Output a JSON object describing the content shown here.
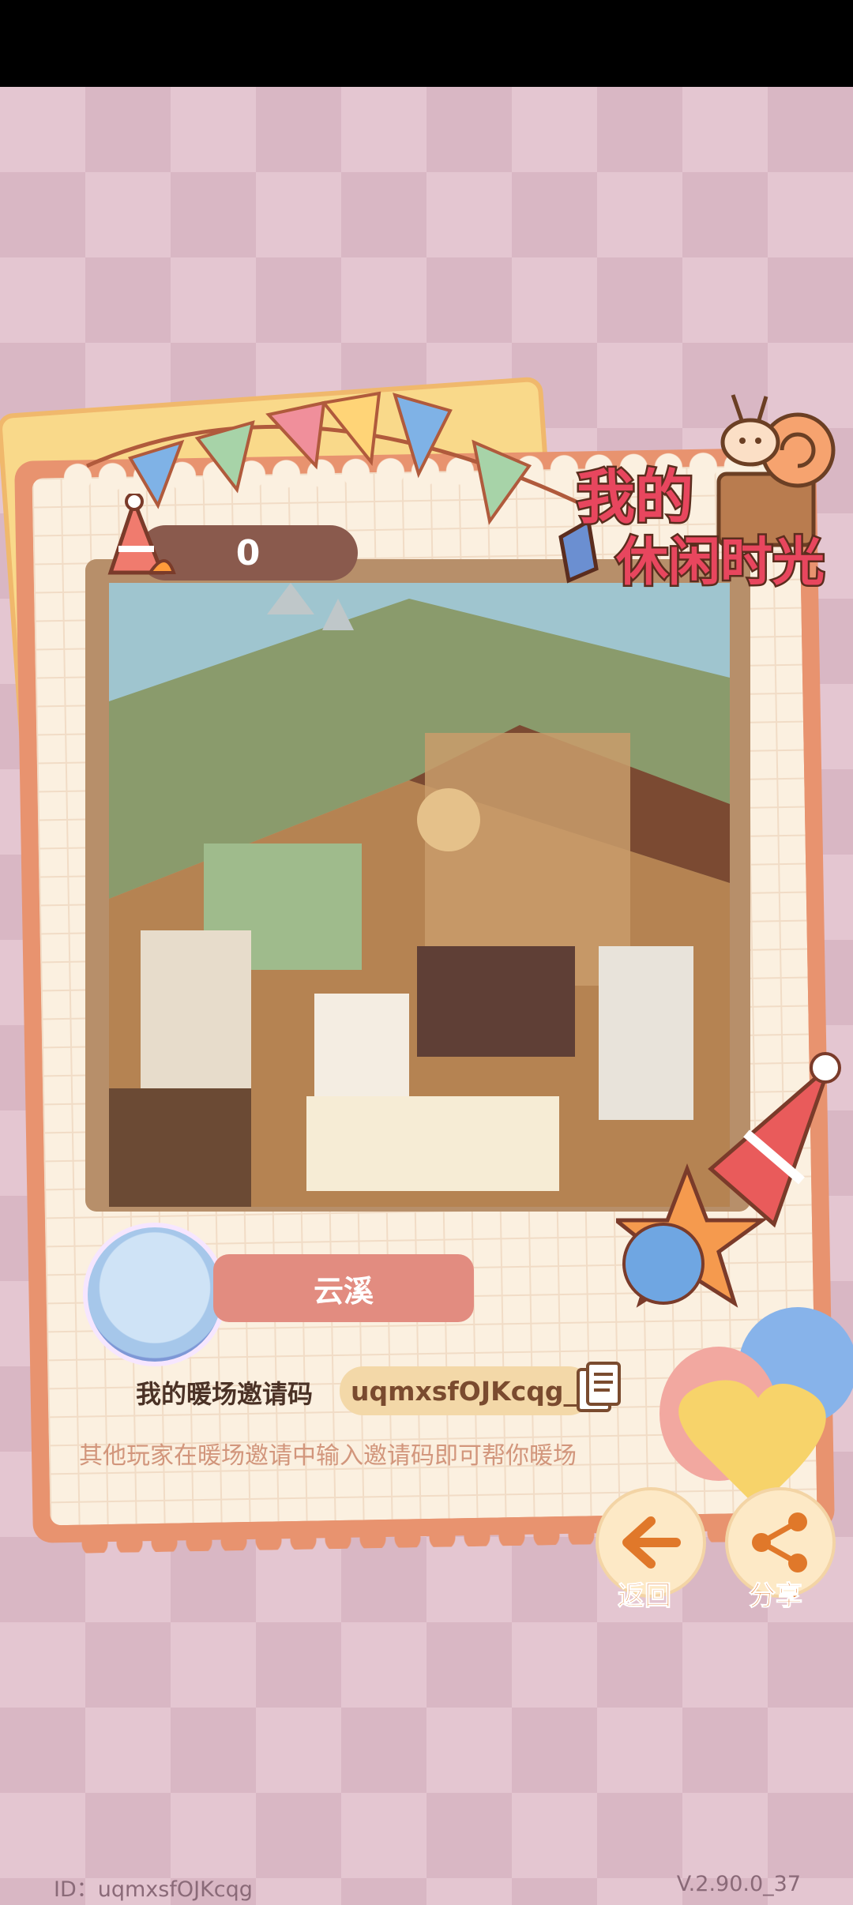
{
  "score": "0",
  "title": {
    "line1": "我的",
    "line2": "休闲时光"
  },
  "player": {
    "name": "云溪"
  },
  "invite": {
    "label": "我的暖场邀请码",
    "code": "uqmxsfOJKcqg_3",
    "hint": "其他玩家在暖场邀请中输入邀请码即可帮你暖场"
  },
  "buttons": {
    "back_label": "返回",
    "share_label": "分享"
  },
  "footer": {
    "id_text": "ID：uqmxsfOJKcqg",
    "version": "V.2.90.0_37"
  },
  "colors": {
    "card_border": "#e8936f",
    "accent_orange": "#e0782a",
    "name_pill": "#e28c80"
  }
}
